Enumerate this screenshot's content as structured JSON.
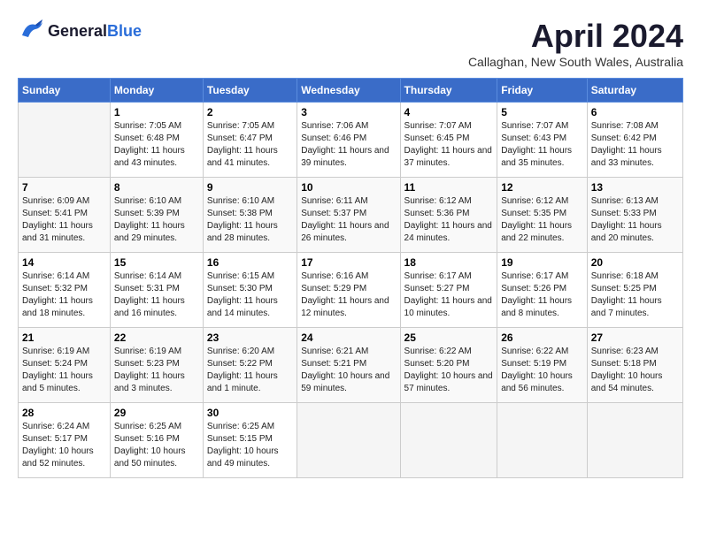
{
  "header": {
    "logo_line1": "General",
    "logo_line2": "Blue",
    "month_title": "April 2024",
    "location": "Callaghan, New South Wales, Australia"
  },
  "days_of_week": [
    "Sunday",
    "Monday",
    "Tuesday",
    "Wednesday",
    "Thursday",
    "Friday",
    "Saturday"
  ],
  "weeks": [
    [
      {
        "day": "",
        "sunrise": "",
        "sunset": "",
        "daylight": ""
      },
      {
        "day": "1",
        "sunrise": "Sunrise: 7:05 AM",
        "sunset": "Sunset: 6:48 PM",
        "daylight": "Daylight: 11 hours and 43 minutes."
      },
      {
        "day": "2",
        "sunrise": "Sunrise: 7:05 AM",
        "sunset": "Sunset: 6:47 PM",
        "daylight": "Daylight: 11 hours and 41 minutes."
      },
      {
        "day": "3",
        "sunrise": "Sunrise: 7:06 AM",
        "sunset": "Sunset: 6:46 PM",
        "daylight": "Daylight: 11 hours and 39 minutes."
      },
      {
        "day": "4",
        "sunrise": "Sunrise: 7:07 AM",
        "sunset": "Sunset: 6:45 PM",
        "daylight": "Daylight: 11 hours and 37 minutes."
      },
      {
        "day": "5",
        "sunrise": "Sunrise: 7:07 AM",
        "sunset": "Sunset: 6:43 PM",
        "daylight": "Daylight: 11 hours and 35 minutes."
      },
      {
        "day": "6",
        "sunrise": "Sunrise: 7:08 AM",
        "sunset": "Sunset: 6:42 PM",
        "daylight": "Daylight: 11 hours and 33 minutes."
      }
    ],
    [
      {
        "day": "7",
        "sunrise": "Sunrise: 6:09 AM",
        "sunset": "Sunset: 5:41 PM",
        "daylight": "Daylight: 11 hours and 31 minutes."
      },
      {
        "day": "8",
        "sunrise": "Sunrise: 6:10 AM",
        "sunset": "Sunset: 5:39 PM",
        "daylight": "Daylight: 11 hours and 29 minutes."
      },
      {
        "day": "9",
        "sunrise": "Sunrise: 6:10 AM",
        "sunset": "Sunset: 5:38 PM",
        "daylight": "Daylight: 11 hours and 28 minutes."
      },
      {
        "day": "10",
        "sunrise": "Sunrise: 6:11 AM",
        "sunset": "Sunset: 5:37 PM",
        "daylight": "Daylight: 11 hours and 26 minutes."
      },
      {
        "day": "11",
        "sunrise": "Sunrise: 6:12 AM",
        "sunset": "Sunset: 5:36 PM",
        "daylight": "Daylight: 11 hours and 24 minutes."
      },
      {
        "day": "12",
        "sunrise": "Sunrise: 6:12 AM",
        "sunset": "Sunset: 5:35 PM",
        "daylight": "Daylight: 11 hours and 22 minutes."
      },
      {
        "day": "13",
        "sunrise": "Sunrise: 6:13 AM",
        "sunset": "Sunset: 5:33 PM",
        "daylight": "Daylight: 11 hours and 20 minutes."
      }
    ],
    [
      {
        "day": "14",
        "sunrise": "Sunrise: 6:14 AM",
        "sunset": "Sunset: 5:32 PM",
        "daylight": "Daylight: 11 hours and 18 minutes."
      },
      {
        "day": "15",
        "sunrise": "Sunrise: 6:14 AM",
        "sunset": "Sunset: 5:31 PM",
        "daylight": "Daylight: 11 hours and 16 minutes."
      },
      {
        "day": "16",
        "sunrise": "Sunrise: 6:15 AM",
        "sunset": "Sunset: 5:30 PM",
        "daylight": "Daylight: 11 hours and 14 minutes."
      },
      {
        "day": "17",
        "sunrise": "Sunrise: 6:16 AM",
        "sunset": "Sunset: 5:29 PM",
        "daylight": "Daylight: 11 hours and 12 minutes."
      },
      {
        "day": "18",
        "sunrise": "Sunrise: 6:17 AM",
        "sunset": "Sunset: 5:27 PM",
        "daylight": "Daylight: 11 hours and 10 minutes."
      },
      {
        "day": "19",
        "sunrise": "Sunrise: 6:17 AM",
        "sunset": "Sunset: 5:26 PM",
        "daylight": "Daylight: 11 hours and 8 minutes."
      },
      {
        "day": "20",
        "sunrise": "Sunrise: 6:18 AM",
        "sunset": "Sunset: 5:25 PM",
        "daylight": "Daylight: 11 hours and 7 minutes."
      }
    ],
    [
      {
        "day": "21",
        "sunrise": "Sunrise: 6:19 AM",
        "sunset": "Sunset: 5:24 PM",
        "daylight": "Daylight: 11 hours and 5 minutes."
      },
      {
        "day": "22",
        "sunrise": "Sunrise: 6:19 AM",
        "sunset": "Sunset: 5:23 PM",
        "daylight": "Daylight: 11 hours and 3 minutes."
      },
      {
        "day": "23",
        "sunrise": "Sunrise: 6:20 AM",
        "sunset": "Sunset: 5:22 PM",
        "daylight": "Daylight: 11 hours and 1 minute."
      },
      {
        "day": "24",
        "sunrise": "Sunrise: 6:21 AM",
        "sunset": "Sunset: 5:21 PM",
        "daylight": "Daylight: 10 hours and 59 minutes."
      },
      {
        "day": "25",
        "sunrise": "Sunrise: 6:22 AM",
        "sunset": "Sunset: 5:20 PM",
        "daylight": "Daylight: 10 hours and 57 minutes."
      },
      {
        "day": "26",
        "sunrise": "Sunrise: 6:22 AM",
        "sunset": "Sunset: 5:19 PM",
        "daylight": "Daylight: 10 hours and 56 minutes."
      },
      {
        "day": "27",
        "sunrise": "Sunrise: 6:23 AM",
        "sunset": "Sunset: 5:18 PM",
        "daylight": "Daylight: 10 hours and 54 minutes."
      }
    ],
    [
      {
        "day": "28",
        "sunrise": "Sunrise: 6:24 AM",
        "sunset": "Sunset: 5:17 PM",
        "daylight": "Daylight: 10 hours and 52 minutes."
      },
      {
        "day": "29",
        "sunrise": "Sunrise: 6:25 AM",
        "sunset": "Sunset: 5:16 PM",
        "daylight": "Daylight: 10 hours and 50 minutes."
      },
      {
        "day": "30",
        "sunrise": "Sunrise: 6:25 AM",
        "sunset": "Sunset: 5:15 PM",
        "daylight": "Daylight: 10 hours and 49 minutes."
      },
      {
        "day": "",
        "sunrise": "",
        "sunset": "",
        "daylight": ""
      },
      {
        "day": "",
        "sunrise": "",
        "sunset": "",
        "daylight": ""
      },
      {
        "day": "",
        "sunrise": "",
        "sunset": "",
        "daylight": ""
      },
      {
        "day": "",
        "sunrise": "",
        "sunset": "",
        "daylight": ""
      }
    ]
  ]
}
